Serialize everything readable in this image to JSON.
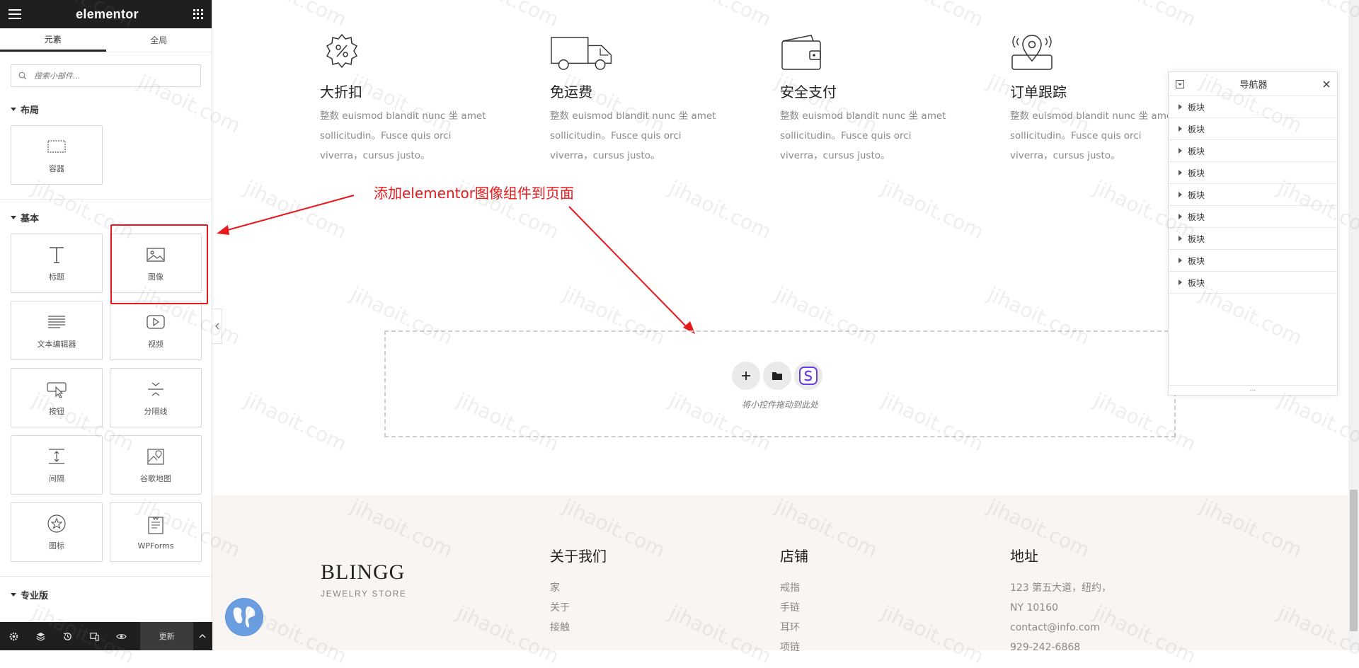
{
  "panel": {
    "brand": "elementor",
    "tabs": [
      {
        "label": "元素"
      },
      {
        "label": "全局"
      }
    ],
    "search_placeholder": "搜索小部件...",
    "sections": [
      {
        "title": "布局",
        "widgets": [
          {
            "label": "容器"
          }
        ]
      },
      {
        "title": "基本",
        "widgets": [
          {
            "label": "标题"
          },
          {
            "label": "图像"
          },
          {
            "label": "文本编辑器"
          },
          {
            "label": "视频"
          },
          {
            "label": "按钮"
          },
          {
            "label": "分隔线"
          },
          {
            "label": "间隔"
          },
          {
            "label": "谷歌地图"
          },
          {
            "label": "图标"
          },
          {
            "label": "WPForms"
          }
        ]
      },
      {
        "title": "专业版",
        "widgets": []
      }
    ],
    "footer": {
      "update_label": "更新"
    }
  },
  "features": [
    {
      "title": "大折扣",
      "desc": "整数 euismod blandit nunc 坐 amet sollicitudin。Fusce quis orci viverra，cursus justo。"
    },
    {
      "title": "免运费",
      "desc": "整数 euismod blandit nunc 坐 amet sollicitudin。Fusce quis orci viverra，cursus justo。"
    },
    {
      "title": "安全支付",
      "desc": "整数 euismod blandit nunc 坐 amet sollicitudin。Fusce quis orci viverra，cursus justo。"
    },
    {
      "title": "订单跟踪",
      "desc": "整数 euismod blandit nunc 坐 amet sollicitudin。Fusce quis orci viverra，cursus justo。"
    }
  ],
  "annotation": "添加elementor图像组件到页面",
  "drop_zone": {
    "hint": "将小控件拖动到此处"
  },
  "footer": {
    "logo": "BLINGG",
    "logo_sub": "JEWELRY STORE",
    "about": {
      "title": "关于我们",
      "items": [
        "家",
        "关于",
        "接触"
      ]
    },
    "shop": {
      "title": "店铺",
      "items": [
        "戒指",
        "手链",
        "耳环",
        "项链"
      ]
    },
    "address": {
      "title": "地址",
      "lines": [
        "123 第五大道，纽约，",
        "NY 10160",
        "contact@info.com",
        "929-242-6868"
      ]
    }
  },
  "navigator": {
    "title": "导航器",
    "items": [
      "板块",
      "板块",
      "板块",
      "板块",
      "板块",
      "板块",
      "板块",
      "板块",
      "板块"
    ],
    "resize_glyph": "..."
  },
  "watermark": "jihaoit.com",
  "colors": {
    "annotation_red": "#e8191c",
    "panel_dark": "#1f1f1f",
    "footer_bg": "#f8f5f2"
  }
}
